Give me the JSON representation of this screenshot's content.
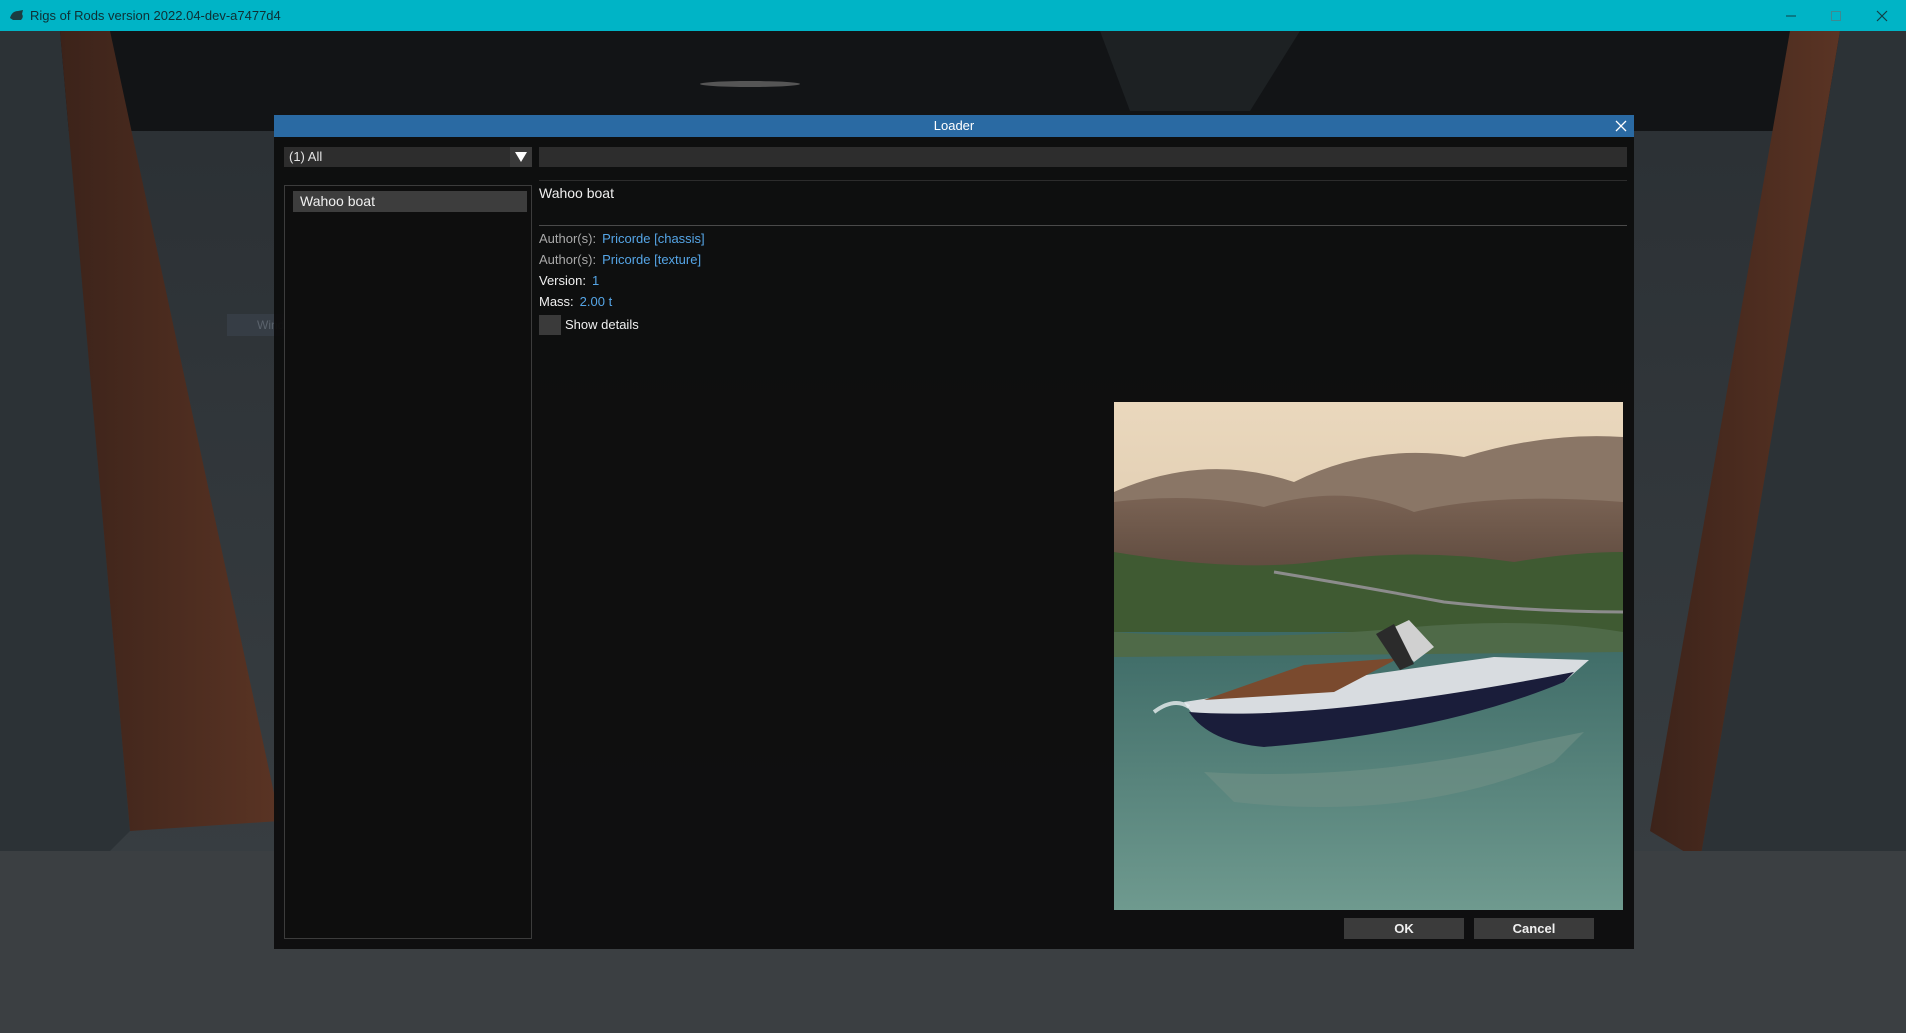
{
  "window": {
    "title": "Rigs of Rods version 2022.04-dev-a7477d4",
    "icon": "ror-logo-icon",
    "controls": [
      "minimize-icon",
      "maximize-icon",
      "close-icon"
    ]
  },
  "background": {
    "ghost_tab_label": "Window Ship"
  },
  "loader": {
    "title": "Loader",
    "header_color": "#2a6aa3",
    "category": {
      "selected": "(1) All",
      "icon": "triangle-down-icon"
    },
    "search": {
      "value": "",
      "placeholder": ""
    },
    "entries": [
      {
        "label": "Wahoo boat",
        "selected": true
      }
    ],
    "details": {
      "title": "Wahoo boat",
      "rows": [
        {
          "label": "Author(s):",
          "value": "Pricorde [chassis]"
        },
        {
          "label": "Author(s):",
          "value": "Pricorde [texture]"
        },
        {
          "label": "Version:",
          "value": "1"
        },
        {
          "label": "Mass:",
          "value": "2.00 t"
        }
      ],
      "show_details": {
        "label": "Show details",
        "checked": false
      },
      "link_color": "#55a5e6"
    },
    "buttons": {
      "ok": "OK",
      "cancel": "Cancel"
    }
  }
}
